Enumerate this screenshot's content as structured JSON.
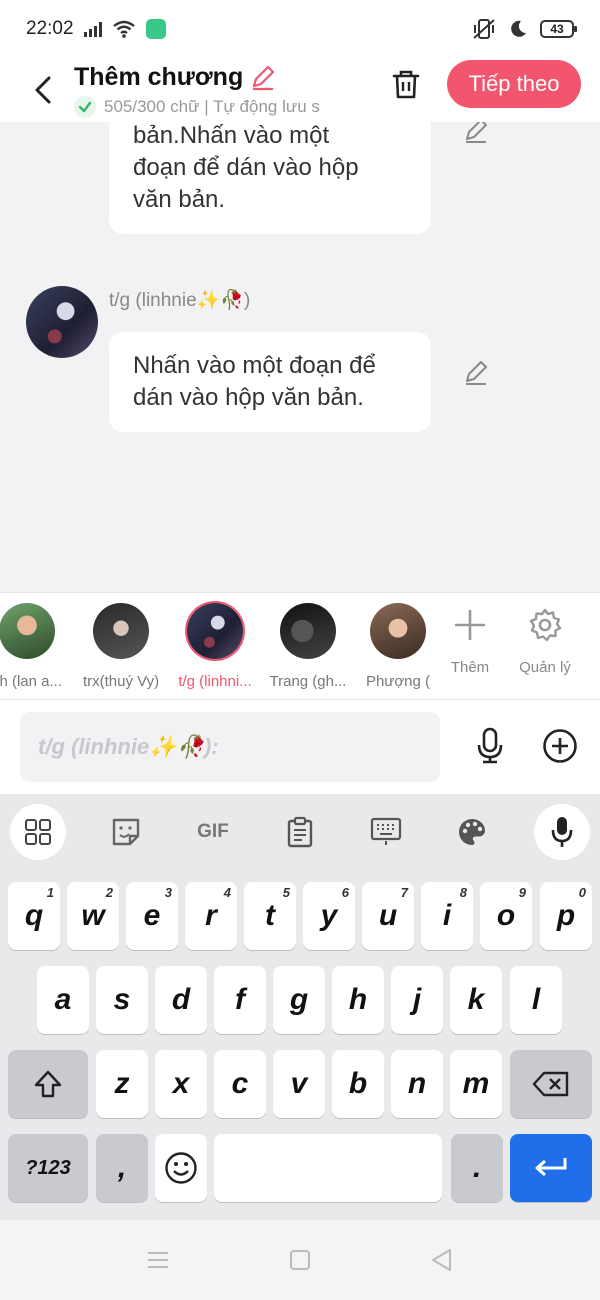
{
  "status": {
    "time": "22:02",
    "battery": "43"
  },
  "header": {
    "title": "Thêm chương",
    "subtitle": "505/300 chữ | Tự động lưu s",
    "next_label": "Tiếp theo"
  },
  "messages": [
    {
      "text_lines": [
        "bản.Nhấn vào một",
        "đoạn để dán vào hộp",
        "văn bản."
      ]
    },
    {
      "sender": "t/g (linhnie✨🥀)",
      "text_lines": [
        "Nhấn vào một đoạn để",
        "dán vào hộp văn bản."
      ]
    }
  ],
  "characters": [
    {
      "name": "ch (lan a..."
    },
    {
      "name": "trx(thuý Vy)"
    },
    {
      "name": "t/g (linhni...",
      "active": true
    },
    {
      "name": "Trang (gh..."
    },
    {
      "name": "Phượng ("
    }
  ],
  "tools": {
    "add_label": "Thêm",
    "manage_label": "Quản lý"
  },
  "input": {
    "placeholder": "t/g (linhnie✨🥀):"
  },
  "keyboard": {
    "row1": [
      {
        "k": "q",
        "n": "1"
      },
      {
        "k": "w",
        "n": "2"
      },
      {
        "k": "e",
        "n": "3"
      },
      {
        "k": "r",
        "n": "4"
      },
      {
        "k": "t",
        "n": "5"
      },
      {
        "k": "y",
        "n": "6"
      },
      {
        "k": "u",
        "n": "7"
      },
      {
        "k": "i",
        "n": "8"
      },
      {
        "k": "o",
        "n": "9"
      },
      {
        "k": "p",
        "n": "0"
      }
    ],
    "row2": [
      "a",
      "s",
      "d",
      "f",
      "g",
      "h",
      "j",
      "k",
      "l"
    ],
    "row3": [
      "z",
      "x",
      "c",
      "v",
      "b",
      "n",
      "m"
    ],
    "symbols_label": "?123",
    "comma": ",",
    "period": ".",
    "gif_label": "GIF"
  }
}
